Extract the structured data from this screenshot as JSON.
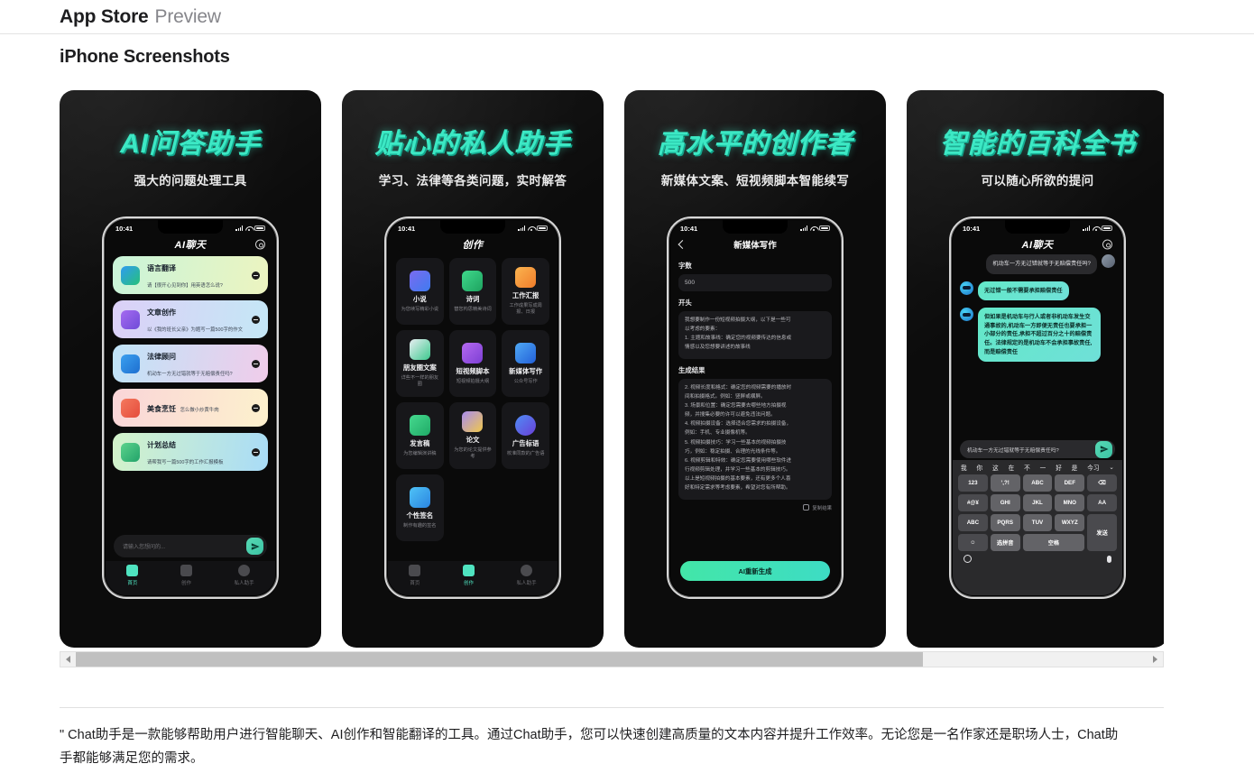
{
  "header": {
    "brand": "App Store",
    "brand_suffix": "Preview",
    "section_title": "iPhone Screenshots"
  },
  "screenshots": [
    {
      "title": "AI问答助手",
      "subtitle": "强大的问题处理工具",
      "phone": {
        "status_time": "10:41",
        "app_title": "AI聊天",
        "gear_icon": "gear-icon",
        "list": [
          {
            "title": "语言翻译",
            "desc": "请【很开心见到你】用英语怎么说?",
            "c1": "#c9f4d9",
            "c2": "#ecf4c0",
            "ic1": "#2f9bf2",
            "ic2": "#27c07a"
          },
          {
            "title": "文章创作",
            "desc": "以《我的班长父亲》为题写一篇500字的作文",
            "c1": "#dcd0f7",
            "c2": "#c4e7f6",
            "ic1": "#a56bf0",
            "ic2": "#6f4bd8"
          },
          {
            "title": "法律顾问",
            "desc": "机动车一方无过错就等于无赔偿责任吗?",
            "c1": "#bfe4f8",
            "c2": "#f0ccea",
            "ic1": "#3aa0ef",
            "ic2": "#1e6fd0"
          },
          {
            "title": "美食烹饪",
            "desc": "怎么做小炒黄牛肉",
            "c1": "#fad5d8",
            "c2": "#fdf1cd",
            "ic1": "#f4795e",
            "ic2": "#e54c3c"
          },
          {
            "title": "计划总结",
            "desc": "请帮我写一篇500字的工作汇报模板",
            "c1": "#d3f3c9",
            "c2": "#a9dcf7",
            "ic1": "#5bd38c",
            "ic2": "#23a36a"
          }
        ],
        "input_placeholder": "请输入您想问的...",
        "send_icon": "send-icon",
        "tabs": [
          {
            "label": "首页",
            "active": true
          },
          {
            "label": "创作",
            "active": false
          },
          {
            "label": "私人助手",
            "active": false
          }
        ]
      }
    },
    {
      "title": "贴心的私人助手",
      "subtitle": "学习、法律等各类问题，实时解答",
      "phone": {
        "status_time": "10:41",
        "app_title": "创作",
        "grid": [
          {
            "title": "小说",
            "desc": "为您续写精彩小说",
            "ic1": "#7a6bf0",
            "ic2": "#3f7bf0"
          },
          {
            "title": "诗词",
            "desc": "替您构思精美诗词",
            "ic1": "#3fd88c",
            "ic2": "#1ea35f"
          },
          {
            "title": "工作汇报",
            "desc": "工作成果写成周报、日报",
            "ic1": "#fbb450",
            "ic2": "#f07c2a"
          },
          {
            "title": "朋友圈文案",
            "desc": "详些不一样的朋友圈",
            "ic1": "#e8eef2",
            "ic2": "#3dc98e"
          },
          {
            "title": "短视频脚本",
            "desc": "短视频拍摄大纲",
            "ic1": "#b469f0",
            "ic2": "#7d3fd4"
          },
          {
            "title": "新媒体写作",
            "desc": "公众号写作",
            "ic1": "#4fa9f5",
            "ic2": "#2360d8"
          },
          {
            "title": "发言稿",
            "desc": "为您编辑演讲稿",
            "ic1": "#46d98f",
            "ic2": "#1faa66"
          },
          {
            "title": "论文",
            "desc": "为您的论文提供参考",
            "ic1": "#a98cf2",
            "ic2": "#f0c84a"
          },
          {
            "title": "广告标语",
            "desc": "校准同款的广告语",
            "ic1": "#4f8df5",
            "ic2": "#6a3fd8"
          },
          {
            "title": "个性签名",
            "desc": "制作有趣的签名",
            "ic1": "#4fc3f7",
            "ic2": "#2a84e0"
          }
        ],
        "tabs": [
          {
            "label": "首页",
            "active": false
          },
          {
            "label": "创作",
            "active": true
          },
          {
            "label": "私人助手",
            "active": false
          }
        ]
      }
    },
    {
      "title": "高水平的创作者",
      "subtitle": "新媒体文案、短视频脚本智能续写",
      "phone": {
        "status_time": "10:41",
        "app_title": "新媒体写作",
        "back_icon": "back-arrow-icon",
        "label_count": "字数",
        "value_count": "500",
        "label_start": "开头",
        "start_lines": [
          "我想要制作一份短视频拍摄大纲，以下是一些可",
          "以考虑的要素：",
          "1. 主题和故事线：确定您的视频要传达的信息或",
          "情感以及您想要讲述的故事线"
        ],
        "label_result": "生成结果",
        "result_lines": [
          "2. 视频长度和格式：确定您的视频需要的播放时",
          "间和拍摄格式。例如：竖屏或横屏。",
          "3. 场景和位置：确定您需要去哪些地方拍摄视",
          "频，并搜集必要的许可以避免违法问题。",
          "4. 视频拍摄设备：选择适合您需求的拍摄设备，",
          "例如：手机、专业摄像机等。",
          "5. 视频拍摄技巧：学习一些基本的视频拍摄技",
          "巧，例如：稳定拍摄、合理的光线条件等。",
          "6. 视频剪辑和特效：确定您需要使用哪些软件进",
          "行视频剪辑处理，并学习一些基本的剪辑技巧。",
          "以上是短视频拍摄的基本要素，还有更多个人喜",
          "好和特定需求等考虑要素，希望对您有所帮助。"
        ],
        "copy_label": "复制结果",
        "copy_icon": "copy-icon",
        "regen_label": "AI重新生成"
      }
    },
    {
      "title": "智能的百科全书",
      "subtitle": "可以随心所欲的提问",
      "phone": {
        "status_time": "10:41",
        "app_title": "AI聊天",
        "gear_icon": "gear-icon",
        "messages": [
          {
            "from": "me",
            "text": "机动车一方无过错就等于无赔偿责任吗?"
          },
          {
            "from": "ai",
            "text": "无过错一般不需要承担赔偿责任"
          },
          {
            "from": "ai",
            "text": "但如果是机动车与行人或者非机动车发生交通事故的,机动车一方即便无责任也要承担一小部分的责任,承担不超过百分之十的赔偿责任。法律规定的是机动车不会承担事故责任,而是赔偿责任"
          }
        ],
        "input_value": "机动车一方无过错就等于无赔偿责任吗?",
        "send_icon": "send-icon",
        "keyboard": {
          "predictions": [
            "我",
            "你",
            "这",
            "在",
            "不",
            "一",
            "好",
            "是",
            "今习"
          ],
          "chevron_icon": "chevron-down-icon",
          "keys": [
            "123",
            "ʼ,?!",
            "ABC",
            "DEF",
            "⌫",
            "#@¥",
            "GHI",
            "JKL",
            "MNO",
            "AA",
            "ABC",
            "PQRS",
            "TUV",
            "WXYZ",
            "发送",
            "☺",
            "选拼音",
            "空格"
          ],
          "globe_icon": "globe-icon",
          "mic_icon": "microphone-icon"
        }
      }
    }
  ],
  "scrollbar": {
    "left_icon": "scroll-left-arrow",
    "right_icon": "scroll-right-arrow",
    "thumb_percent": 79
  },
  "description": "\" Chat助手是一款能够帮助用户进行智能聊天、AI创作和智能翻译的工具。通过Chat助手，您可以快速创建高质量的文本内容并提升工作效率。无论您是一名作家还是职场人士，Chat助手都能够满足您的需求。"
}
